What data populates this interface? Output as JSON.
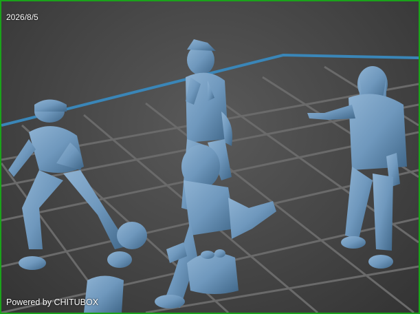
{
  "viewport": {
    "date": "2026/8/5",
    "watermark": "Powered by CHITUBOX",
    "frame_color": "#1aa31a",
    "platform_edge_color": "#3a86b8",
    "grid_line_color": "#6a6a6a",
    "model_color": "#6f98bd",
    "model_shade_color": "#3f6688"
  },
  "models": [
    {
      "name": "crouching-figure-with-cap"
    },
    {
      "name": "figure-with-spray-can-and-bag"
    },
    {
      "name": "kneeling-figure-with-bag"
    },
    {
      "name": "pointing-figure-with-hoodie"
    }
  ]
}
